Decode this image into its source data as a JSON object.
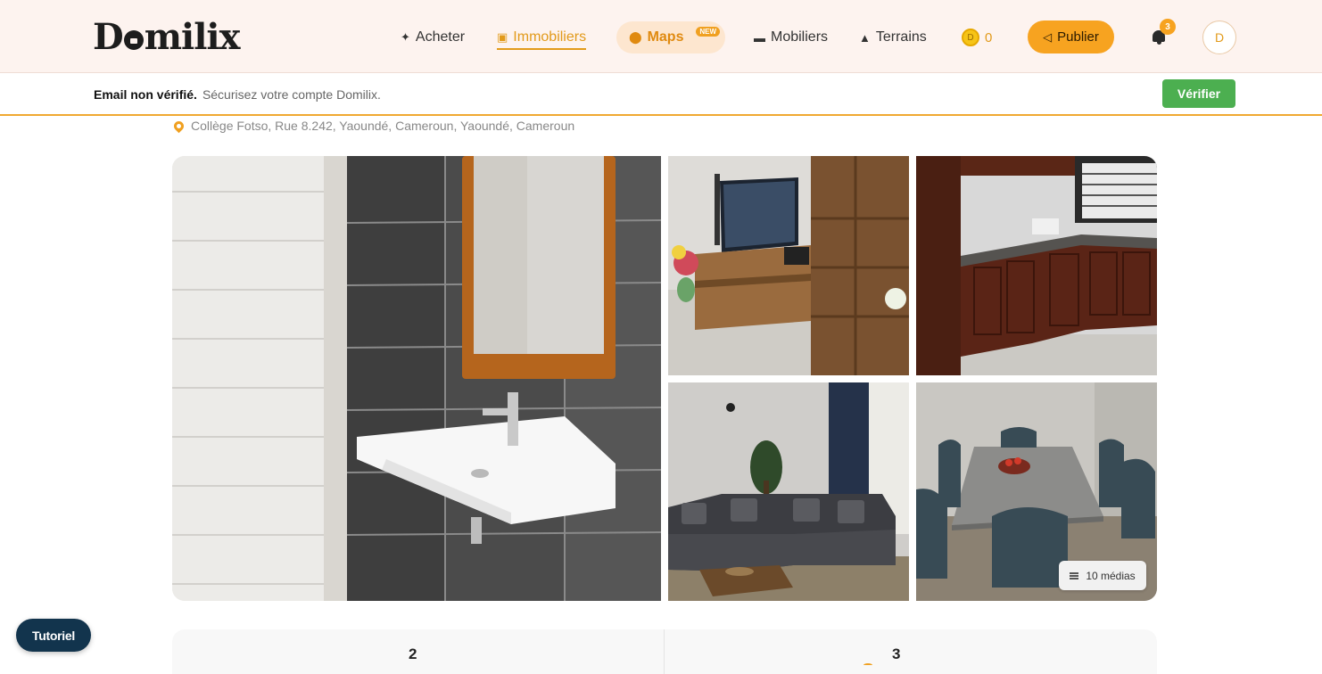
{
  "header": {
    "logo_text_left": "D",
    "logo_text_right": "milix",
    "nav": [
      {
        "label": "Acheter",
        "icon": "sparkle-icon"
      },
      {
        "label": "Immobiliers",
        "icon": "building-icon",
        "active": true
      },
      {
        "label": "Maps",
        "icon": "map-pin-icon",
        "badge": "NEW"
      },
      {
        "label": "Mobiliers",
        "icon": "sofa-icon"
      },
      {
        "label": "Terrains",
        "icon": "mountain-icon"
      }
    ],
    "coin_symbol": "D",
    "coin_count": "0",
    "publish_label": "Publier",
    "notifications_count": "3",
    "avatar_initial": "D"
  },
  "email_bar": {
    "title": "Email non vérifié.",
    "message": "Sécurisez votre compte Domilix.",
    "verify_label": "Vérifier"
  },
  "listing": {
    "address": "Collège Fotso, Rue 8.242, Yaoundé, Cameroun, Yaoundé, Cameroun",
    "media_label": "10 médias",
    "stats": [
      "2",
      "3"
    ]
  },
  "tutorial_label": "Tutoriel",
  "colors": {
    "accent": "#f7a320",
    "header_bg": "#fdf3ef",
    "verify": "#4caf50",
    "tutorial": "#12344d"
  }
}
